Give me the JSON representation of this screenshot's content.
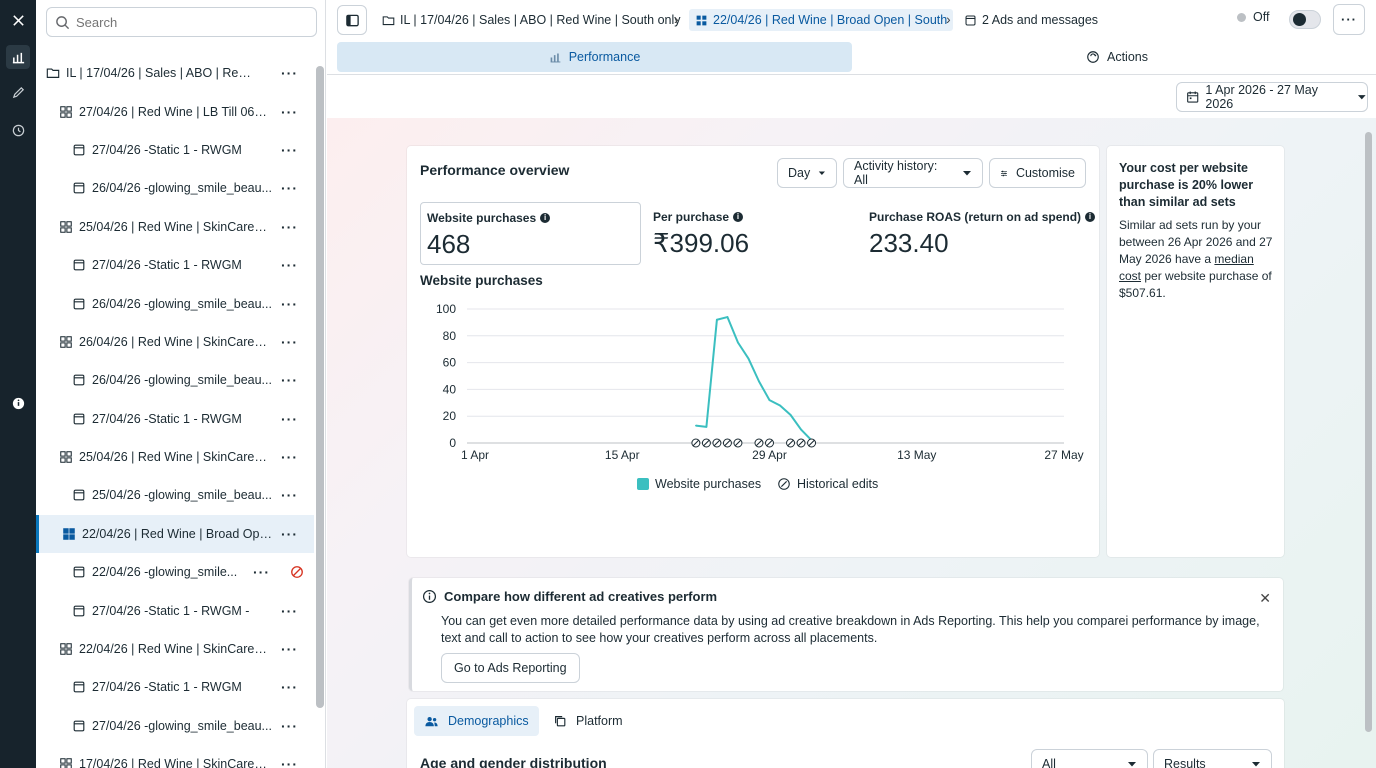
{
  "tree": {
    "search_placeholder": "Search",
    "items": [
      {
        "label": "IL | 17/04/26 | Sales | ABO | Red Win...",
        "level": 0,
        "type": "campaign"
      },
      {
        "label": "27/04/26 | Red Wine | LB Till 06/0...",
        "level": 1,
        "type": "adset"
      },
      {
        "label": "27/04/26 -Static 1 - RWGM",
        "level": 2,
        "type": "ad"
      },
      {
        "label": "26/04/26 -glowing_smile_beau...",
        "level": 2,
        "type": "ad"
      },
      {
        "label": "25/04/26 | Red Wine | SkinCare | ...",
        "level": 1,
        "type": "adset"
      },
      {
        "label": "27/04/26 -Static 1 - RWGM",
        "level": 2,
        "type": "ad"
      },
      {
        "label": "26/04/26 -glowing_smile_beau...",
        "level": 2,
        "type": "ad"
      },
      {
        "label": "26/04/26 | Red Wine | SkinCare | ...",
        "level": 1,
        "type": "adset"
      },
      {
        "label": "26/04/26 -glowing_smile_beau...",
        "level": 2,
        "type": "ad"
      },
      {
        "label": "27/04/26 -Static 1 - RWGM",
        "level": 2,
        "type": "ad"
      },
      {
        "label": "25/04/26 | Red Wine | SkinCare | ...",
        "level": 1,
        "type": "adset"
      },
      {
        "label": "25/04/26 -glowing_smile_beau...",
        "level": 2,
        "type": "ad"
      },
      {
        "label": "22/04/26 | Red Wine | Broad Ope...",
        "level": 1,
        "type": "adset",
        "selected": true
      },
      {
        "label": "22/04/26 -glowing_smile...",
        "level": 2,
        "type": "ad",
        "stopped": true
      },
      {
        "label": "27/04/26 -Static 1 - RWGM -",
        "level": 2,
        "type": "ad"
      },
      {
        "label": "22/04/26 | Red Wine | SkinCare | ...",
        "level": 1,
        "type": "adset"
      },
      {
        "label": "27/04/26 -Static 1 - RWGM",
        "level": 2,
        "type": "ad"
      },
      {
        "label": "27/04/26 -glowing_smile_beau...",
        "level": 2,
        "type": "ad"
      },
      {
        "label": "17/04/26 | Red Wine | SkinCare | S...",
        "level": 1,
        "type": "adset"
      }
    ]
  },
  "header": {
    "breadcrumb_campaign": "IL | 17/04/26 | Sales | ABO | Red Wine | South only",
    "breadcrumb_adset": "22/04/26 | Red Wine | Broad Open | South",
    "breadcrumb_ads": "2 Ads and messages",
    "status": "Off",
    "more": "···"
  },
  "tabs": {
    "performance": "Performance",
    "actions": "Actions"
  },
  "date_range": "1 Apr 2026 - 27 May 2026",
  "overview": {
    "title": "Performance overview",
    "granularity": "Day",
    "activity_history": "Activity history: All",
    "customise": "Customise",
    "metrics": [
      {
        "label": "Website purchases",
        "value": "468"
      },
      {
        "label": "Per purchase",
        "value": "₹399.06"
      },
      {
        "label": "Purchase ROAS (return on ad spend)",
        "value": "233.40"
      }
    ],
    "chart_title": "Website purchases",
    "legend_series": "Website purchases",
    "legend_edits": "Historical edits"
  },
  "chart_data": {
    "type": "line",
    "title": "Website purchases",
    "x_tick_labels": [
      "1 Apr",
      "15 Apr",
      "29 Apr",
      "13 May",
      "27 May"
    ],
    "ylim": [
      0,
      100
    ],
    "y_ticks": [
      0,
      20,
      40,
      60,
      80,
      100
    ],
    "grid": true,
    "legend_placement": "bottom",
    "series": [
      {
        "name": "Website purchases",
        "color": "#3bbfc0",
        "x": [
          "22 Apr",
          "23 Apr",
          "24 Apr",
          "25 Apr",
          "26 Apr",
          "27 Apr",
          "28 Apr",
          "29 Apr",
          "30 Apr",
          "1 May",
          "2 May",
          "3 May"
        ],
        "values": [
          13,
          12,
          92,
          94,
          75,
          63,
          46,
          32,
          28,
          21,
          10,
          2
        ]
      }
    ],
    "edit_markers": [
      "22 Apr",
      "23 Apr",
      "24 Apr",
      "25 Apr",
      "26 Apr",
      "28 Apr",
      "29 Apr",
      "1 May",
      "2 May",
      "3 May"
    ]
  },
  "insight": {
    "title": "Your cost per website purchase is 20% lower than similar ad sets",
    "body_prefix": "Similar ad sets run by your between 26 Apr 2026 and 27 May 2026 have a ",
    "body_link": "median cost",
    "body_suffix": " per website purchase of $507.61."
  },
  "compare": {
    "title": "Compare how different ad creatives perform",
    "body": "You can get even more detailed performance data by using ad creative breakdown in Ads Reporting. This help you comparei performance by image, text and call to action to see how your creatives perform across all placements.",
    "button": "Go to Ads Reporting"
  },
  "demographics": {
    "tab_demographics": "Demographics",
    "tab_platform": "Platform",
    "section_title": "Age and gender distribution",
    "filter": "All",
    "metric": "Results"
  }
}
